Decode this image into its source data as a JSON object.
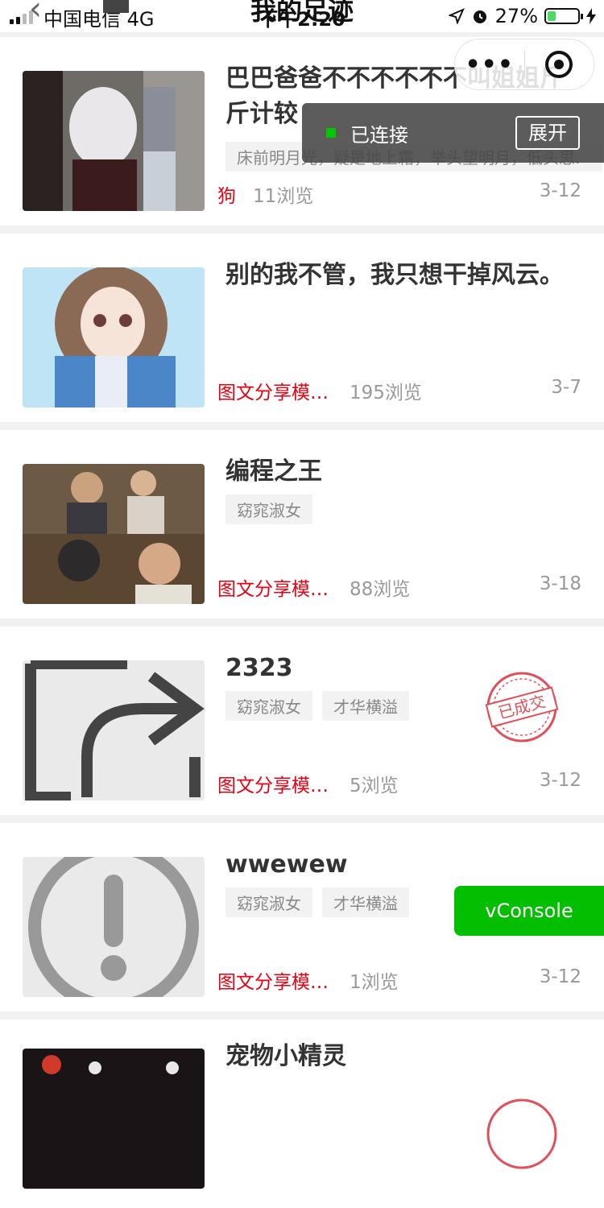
{
  "status_bar": {
    "carrier": "中国电信  4G",
    "time": "下午2:20",
    "battery": "27%",
    "battery_level": 0.27
  },
  "nav": {
    "title": "我的足迹"
  },
  "capsule": {
    "more": "•••"
  },
  "connected": {
    "label": "已连接",
    "expand": "展开"
  },
  "items": [
    {
      "title": "巴巴爸爸不不不不不不叫姐姐斤斤计较",
      "tags": [
        "床前明月光，疑是地上霜，举头望明月，低头思."
      ],
      "category": "狗",
      "views": "11浏览",
      "date": "3-12",
      "sold": false
    },
    {
      "title": "别的我不管，我只想干掉风云。",
      "tags": [],
      "category": "图文分享模…",
      "views": "195浏览",
      "date": "3-7",
      "sold": false
    },
    {
      "title": "编程之王",
      "tags": [
        "窈窕淑女"
      ],
      "category": "图文分享模…",
      "views": "88浏览",
      "date": "3-18",
      "sold": false
    },
    {
      "title": "2323",
      "tags": [
        "窈窕淑女",
        "才华横溢"
      ],
      "category": "图文分享模…",
      "views": "5浏览",
      "date": "3-12",
      "sold": true
    },
    {
      "title": "wwewew",
      "tags": [
        "窈窕淑女",
        "才华横溢"
      ],
      "category": "图文分享模…",
      "views": "1浏览",
      "date": "3-12",
      "sold": false
    },
    {
      "title": "宠物小精灵",
      "tags": [],
      "category": "",
      "views": "",
      "date": "",
      "sold": true
    }
  ],
  "stamp_text": "已成交",
  "vconsole": {
    "label": "vConsole"
  },
  "colors": {
    "accent_red": "#e60012",
    "vconsole_green": "#04be02",
    "connected_dot": "#00c800"
  }
}
